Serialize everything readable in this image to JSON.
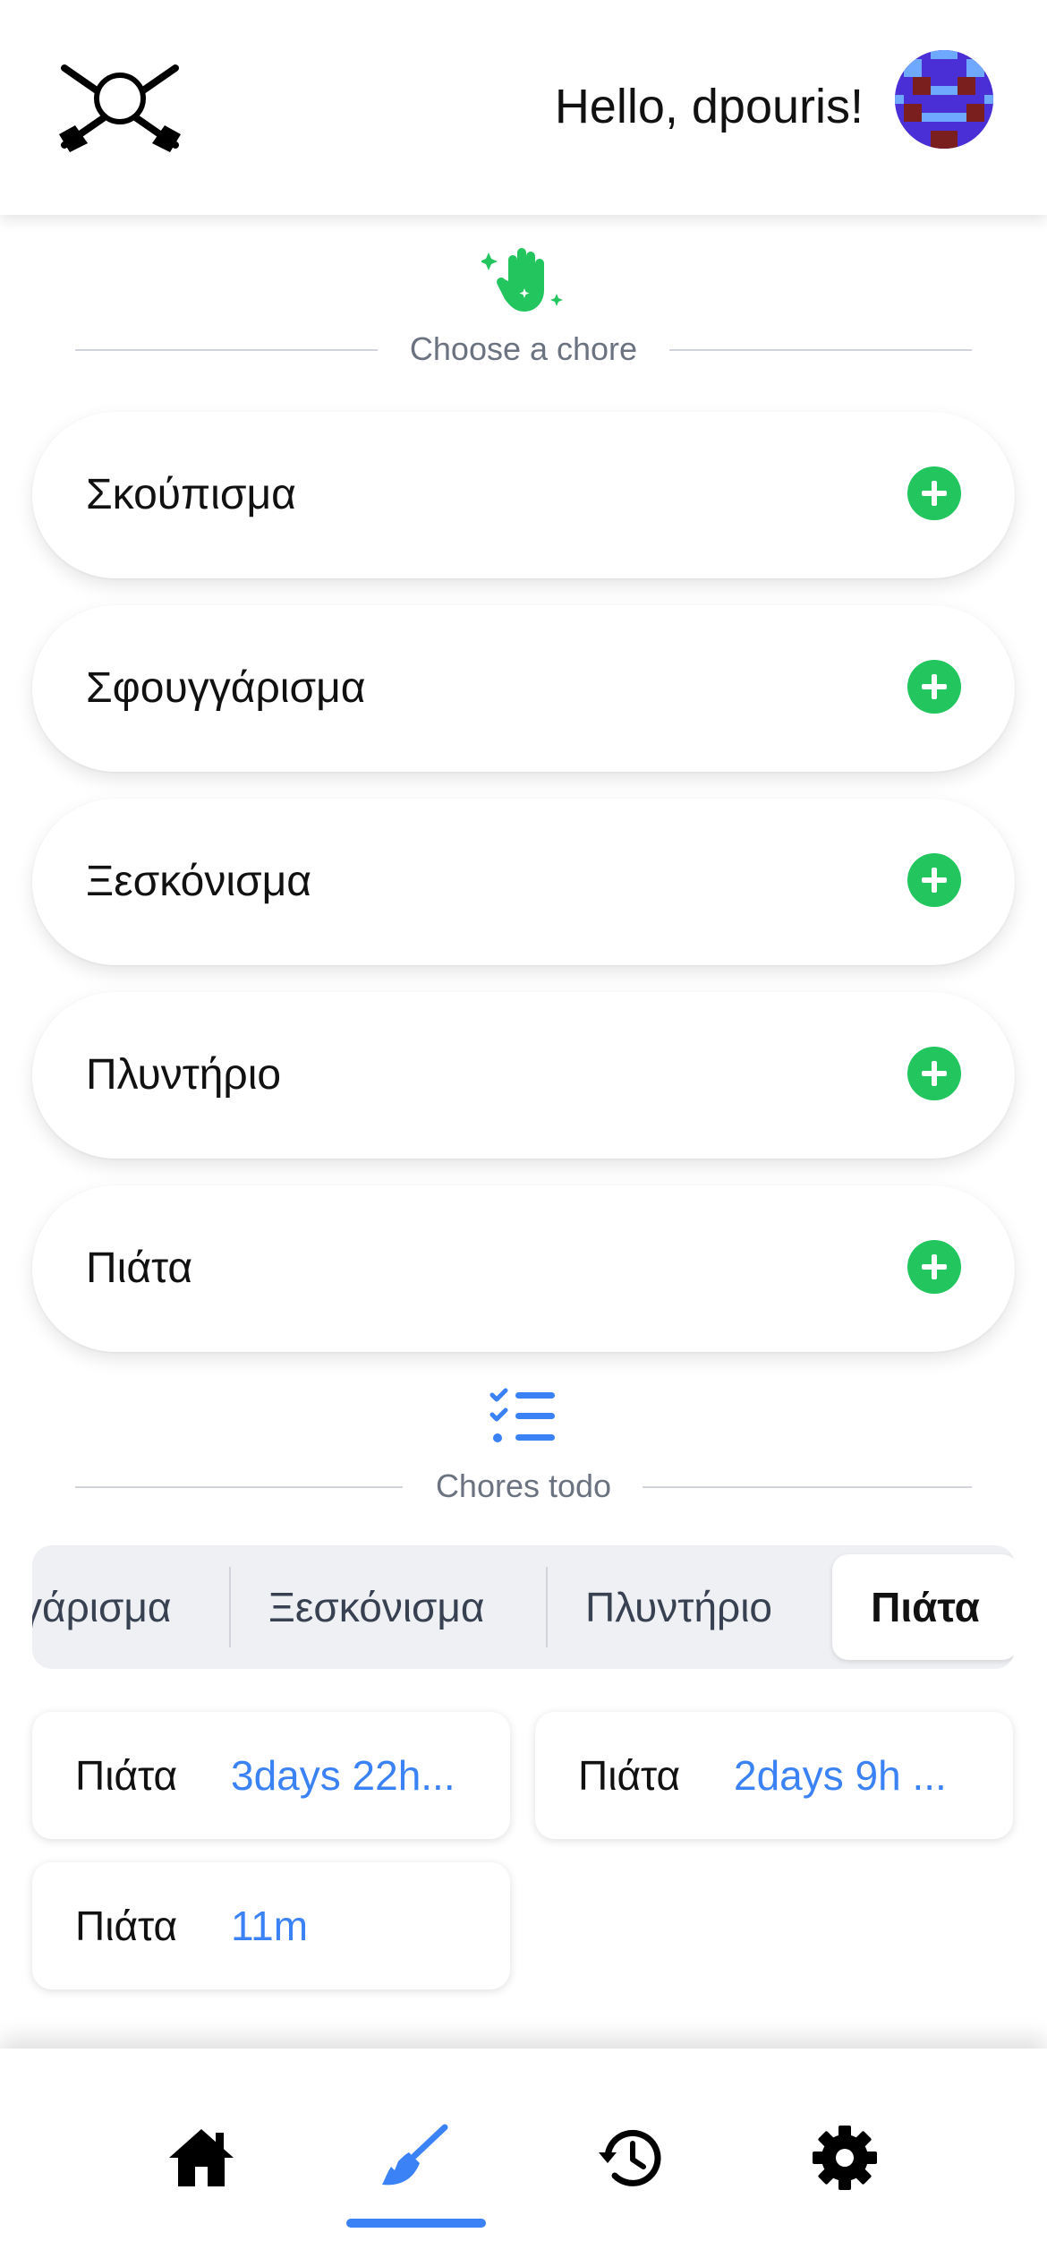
{
  "header": {
    "greeting": "Hello, dpouris!",
    "logo_icon": "crossed-brooms-icon",
    "avatar_icon": "pixel-avatar"
  },
  "choose_section": {
    "icon": "sparkling-hand-icon",
    "title": "Choose a chore",
    "icon_color": "#22c55e"
  },
  "chores": [
    {
      "label": "Σκούπισμα"
    },
    {
      "label": "Σφουγγάρισμα"
    },
    {
      "label": "Ξεσκόνισμα"
    },
    {
      "label": "Πλυντήριο"
    },
    {
      "label": "Πιάτα"
    }
  ],
  "todo_section": {
    "icon": "checklist-icon",
    "title": "Chores todo",
    "icon_color": "#3b82f6"
  },
  "tabs": [
    {
      "label": "γάρισμα"
    },
    {
      "label": "Ξεσκόνισμα"
    },
    {
      "label": "Πλυντήριο"
    },
    {
      "label": "Πιάτα",
      "active": true
    }
  ],
  "todos": [
    {
      "name": "Πιάτα",
      "time": "3days 22h..."
    },
    {
      "name": "Πιάτα",
      "time": "2days 9h ..."
    },
    {
      "name": "Πιάτα",
      "time": "11m"
    }
  ],
  "nav": {
    "items": [
      "home-icon",
      "broom-icon",
      "history-icon",
      "gear-icon"
    ],
    "active": "broom-icon",
    "accent": "#3b82f6"
  }
}
